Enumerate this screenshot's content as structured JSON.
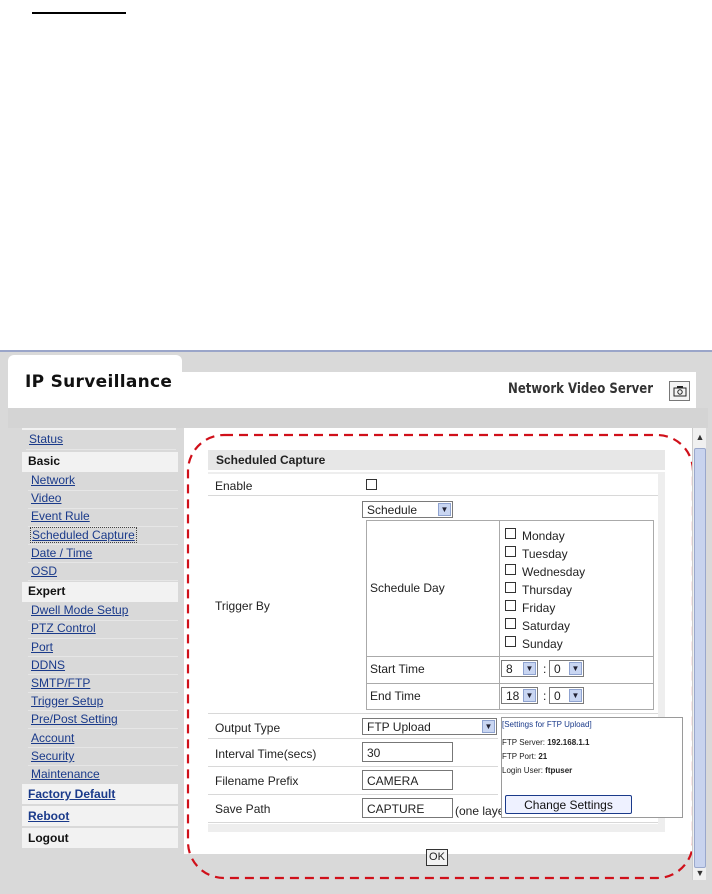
{
  "header": {
    "brand": "IP Surveillance",
    "server_name": "Network Video Server"
  },
  "sidebar": {
    "status": "Status",
    "basic_header": "Basic",
    "basic_items": [
      "Network",
      "Video",
      "Event Rule",
      "Scheduled Capture",
      "Date / Time",
      "OSD"
    ],
    "expert_header": "Expert",
    "expert_items": [
      "Dwell Mode Setup",
      "PTZ Control",
      "Port",
      "DDNS",
      "SMTP/FTP",
      "Trigger Setup",
      "Pre/Post Setting",
      "Account",
      "Security",
      "Maintenance"
    ],
    "factory_default": "Factory Default",
    "reboot": "Reboot",
    "logout": "Logout"
  },
  "panel": {
    "title": "Scheduled Capture",
    "enable_label": "Enable",
    "trigger_by_label": "Trigger By",
    "trigger_select": "Schedule",
    "schedule_day_label": "Schedule Day",
    "days": [
      "Monday",
      "Tuesday",
      "Wednesday",
      "Thursday",
      "Friday",
      "Saturday",
      "Sunday"
    ],
    "start_time_label": "Start Time",
    "start_hour": "8",
    "start_minute": "0",
    "end_time_label": "End Time",
    "end_hour": "18",
    "end_minute": "0",
    "time_sep": ":",
    "output_type_label": "Output Type",
    "output_type": "FTP Upload",
    "interval_label": "Interval Time(secs)",
    "interval_value": "30",
    "prefix_label": "Filename Prefix",
    "prefix_value": "CAMERA",
    "save_path_label": "Save Path",
    "save_path_value": "CAPTURE",
    "save_path_note": "(one layer"
  },
  "ftp_info": {
    "title": "[Settings for FTP Upload]",
    "server_label": "FTP Server:",
    "server_value": "192.168.1.1",
    "port_label": "FTP Port:",
    "port_value": "21",
    "user_label": "Login User:",
    "user_value": "ftpuser",
    "change_button": "Change Settings"
  },
  "ok_button": "OK",
  "colors": {
    "link": "#1a3a8a",
    "highlight_dash": "#d0101a",
    "frame": "#d9d9d9"
  }
}
